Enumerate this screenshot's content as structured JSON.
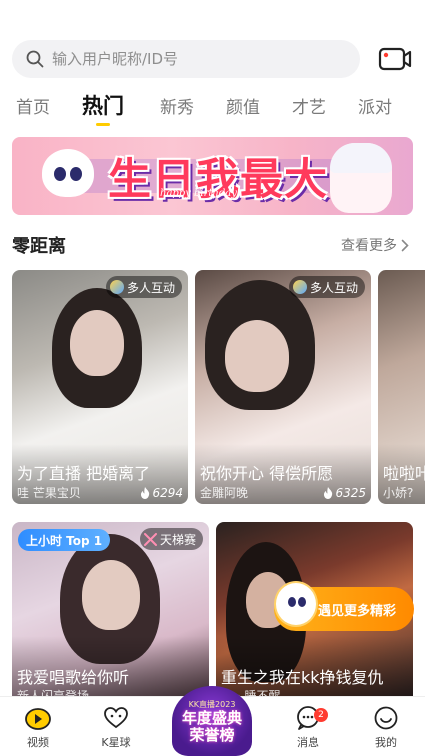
{
  "search": {
    "placeholder": "输入用户昵称/ID号"
  },
  "tabs": [
    {
      "label": "首页",
      "active": false
    },
    {
      "label": "热门",
      "active": true
    },
    {
      "label": "新秀",
      "active": false
    },
    {
      "label": "颜值",
      "active": false
    },
    {
      "label": "才艺",
      "active": false
    },
    {
      "label": "派对",
      "active": false
    }
  ],
  "banner": {
    "title": "生日我最大",
    "subtitle": "happy birthday"
  },
  "section": {
    "title": "零距离",
    "see_more": "查看更多"
  },
  "cards": [
    {
      "tag": "多人互动",
      "title": "为了直播 把婚离了",
      "name": "哇 芒果宝贝",
      "count": "6294"
    },
    {
      "tag": "多人互动",
      "title": "祝你开心 得偿所愿",
      "name": "金雕阿晚",
      "count": "6325"
    },
    {
      "title": "啦啦咔",
      "name": "小娇?"
    }
  ],
  "feed": [
    {
      "rank_tag": "上小时 Top 1",
      "tag": "天梯赛",
      "title": "我爱唱歌给你听",
      "name": "新人闪亮登场"
    },
    {
      "title": "重生之我在kk挣钱复仇",
      "name": "鑫 · 睡不醒"
    }
  ],
  "promo": {
    "label": "遇见更多精彩"
  },
  "award": {
    "top": "KK直播2023",
    "main_line1": "年度盛典",
    "main_line2": "荣誉榜"
  },
  "nav": {
    "video": "视频",
    "kplanet": "K星球",
    "messages": "消息",
    "messages_badge": "2",
    "me": "我的"
  },
  "colors": {
    "accent": "#ffcc00",
    "badge": "#ff3b30",
    "promo": "#ff9a00"
  }
}
